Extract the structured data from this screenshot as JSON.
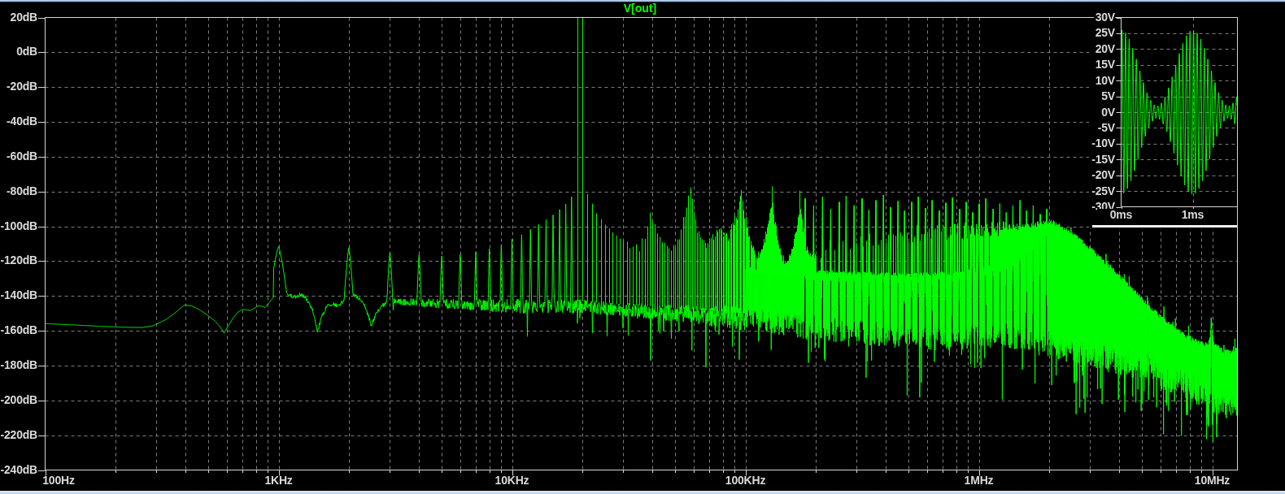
{
  "window": {
    "background": "#000000",
    "chrome_color": "#b9d1f4"
  },
  "chart_data": [
    {
      "type": "line",
      "name": "fft-of-V(out)",
      "title": "V[out]",
      "trace_color": "#00ff00",
      "grid_color": "#7e7e7e",
      "border_color": "#d6d6d6",
      "label_color": "#dadada",
      "x_scale": "log",
      "x_range_hz": [
        100,
        12830000
      ],
      "y_range_db": [
        -240,
        20
      ],
      "y_step_db": 20,
      "grid": true,
      "y_tick_labels": [
        "20dB",
        "0dB",
        "-20dB",
        "-40dB",
        "-60dB",
        "-80dB",
        "-100dB",
        "-120dB",
        "-140dB",
        "-160dB",
        "-180dB",
        "-200dB",
        "-220dB",
        "-240dB"
      ],
      "x_tick_labels": [
        "100Hz",
        "1KHz",
        "10KHz",
        "100KHz",
        "1MHz",
        "10MHz"
      ],
      "x_tick_hz": [
        100,
        1000,
        10000,
        100000,
        1000000,
        10000000
      ],
      "carrier_peak": {
        "freq_hz": 20000,
        "clipped_above_db": 20,
        "sideband_hz": 19000
      },
      "comb_spacing_hz": 1000,
      "low_freq_curve_hz_db": [
        [
          100,
          -155.9
        ],
        [
          130,
          -156.6
        ],
        [
          170,
          -157.4
        ],
        [
          220,
          -158.0
        ],
        [
          260,
          -158.1
        ],
        [
          290,
          -157.2
        ],
        [
          330,
          -153.5
        ],
        [
          360,
          -149.8
        ],
        [
          395,
          -145.2
        ],
        [
          420,
          -145.6
        ],
        [
          450,
          -147.3
        ],
        [
          490,
          -150.5
        ],
        [
          530,
          -154.0
        ],
        [
          560,
          -157.5
        ],
        [
          585,
          -161.3
        ],
        [
          610,
          -157.0
        ],
        [
          640,
          -152.5
        ],
        [
          670,
          -149.3
        ],
        [
          700,
          -147.7
        ],
        [
          730,
          -148.0
        ],
        [
          760,
          -148.3
        ],
        [
          790,
          -146.9
        ],
        [
          820,
          -145.6
        ],
        [
          850,
          -145.9
        ],
        [
          875,
          -146.8
        ],
        [
          900,
          -144.6
        ],
        [
          930,
          -142.3
        ],
        [
          955,
          -140.5
        ],
        [
          975,
          -139.2
        ]
      ],
      "comb_envelope_hz_db": [
        [
          1000,
          -111.7
        ],
        [
          2000,
          -112.3
        ],
        [
          3000,
          -114.8
        ],
        [
          4000,
          -116.3
        ],
        [
          5000,
          -117.0
        ],
        [
          6000,
          -116.2
        ],
        [
          7000,
          -114.6
        ],
        [
          8000,
          -112.8
        ],
        [
          9000,
          -110.4
        ],
        [
          10000,
          -107.4
        ],
        [
          11000,
          -104.8
        ],
        [
          12000,
          -101.8
        ],
        [
          13000,
          -99.0
        ],
        [
          14000,
          -96.2
        ],
        [
          15000,
          -93.4
        ],
        [
          16000,
          -90.4
        ],
        [
          17000,
          -87.2
        ],
        [
          18000,
          -83.0
        ],
        [
          21000,
          -81.5
        ],
        [
          22000,
          -87.0
        ],
        [
          23000,
          -92.5
        ],
        [
          24000,
          -96.0
        ],
        [
          25000,
          -99.0
        ],
        [
          27000,
          -103.5
        ],
        [
          29000,
          -107.0
        ],
        [
          31000,
          -109.5
        ],
        [
          33000,
          -111.0
        ],
        [
          35000,
          -112.0
        ],
        [
          36500,
          -108.0
        ],
        [
          38000,
          -99.0
        ],
        [
          39000,
          -94.0
        ],
        [
          40000,
          -95.5
        ],
        [
          41000,
          -99.0
        ],
        [
          42500,
          -105.0
        ],
        [
          44000,
          -109.0
        ],
        [
          46000,
          -112.0
        ],
        [
          48000,
          -112.5
        ],
        [
          50000,
          -110.0
        ],
        [
          52000,
          -105.0
        ],
        [
          54000,
          -97.0
        ],
        [
          55000,
          -93.0
        ],
        [
          56000,
          -87.0
        ],
        [
          57000,
          -82.0
        ],
        [
          58000,
          -77.3
        ],
        [
          59000,
          -86.0
        ],
        [
          60000,
          -92.0
        ],
        [
          61000,
          -97.0
        ],
        [
          62000,
          -102.0
        ],
        [
          64000,
          -107.0
        ],
        [
          66000,
          -110.0
        ],
        [
          68000,
          -110.5
        ],
        [
          70000,
          -109.0
        ],
        [
          72000,
          -106.5
        ],
        [
          74000,
          -104.0
        ],
        [
          76000,
          -102.0
        ],
        [
          78000,
          -103.0
        ],
        [
          80000,
          -105.0
        ],
        [
          82000,
          -106.5
        ],
        [
          84000,
          -106.0
        ],
        [
          86000,
          -103.0
        ],
        [
          88000,
          -99.0
        ],
        [
          90000,
          -95.0
        ],
        [
          92000,
          -95.0
        ],
        [
          94000,
          -88.0
        ],
        [
          95000,
          -83.0
        ],
        [
          96000,
          -77.6
        ],
        [
          97000,
          -87.0
        ],
        [
          98500,
          -93.0
        ],
        [
          101000,
          -99.0
        ],
        [
          103000,
          -104.0
        ],
        [
          106000,
          -110.0
        ],
        [
          109000,
          -114.0
        ],
        [
          112000,
          -116.5
        ],
        [
          115000,
          -116.0
        ],
        [
          118000,
          -112.0
        ],
        [
          121000,
          -107.0
        ],
        [
          124000,
          -100.0
        ],
        [
          127000,
          -94.0
        ],
        [
          129000,
          -89.0
        ],
        [
          130000,
          -78.6
        ],
        [
          131000,
          -89.0
        ],
        [
          133000,
          -97.0
        ],
        [
          134000,
          -99.0
        ],
        [
          137000,
          -107.0
        ],
        [
          140000,
          -113.0
        ],
        [
          144000,
          -118.0
        ],
        [
          148000,
          -120.5
        ],
        [
          152000,
          -119.0
        ],
        [
          157000,
          -114.0
        ],
        [
          162000,
          -107.0
        ],
        [
          166000,
          -99.0
        ],
        [
          168500,
          -95.0
        ],
        [
          170000,
          -88.0
        ],
        [
          171000,
          -79.2
        ],
        [
          172000,
          -89.0
        ],
        [
          174000,
          -97.0
        ],
        [
          176000,
          -101.0
        ],
        [
          180000,
          -109.0
        ],
        [
          185000,
          -115.0
        ],
        [
          190000,
          -118.0
        ],
        [
          196000,
          -118.0
        ],
        [
          215000,
          -113.0
        ],
        [
          250000,
          -110.0
        ],
        [
          300000,
          -107.5
        ],
        [
          400000,
          -105.5
        ],
        [
          550000,
          -104.0
        ],
        [
          800000,
          -102.5
        ],
        [
          1200000,
          -101.0
        ],
        [
          1600000,
          -99.5
        ],
        [
          1900000,
          -98.3
        ],
        [
          2050000,
          -98.0
        ],
        [
          2200000,
          -99.5
        ],
        [
          2400000,
          -102.5
        ],
        [
          2700000,
          -107.5
        ],
        [
          3000000,
          -112.5
        ],
        [
          3400000,
          -119.0
        ],
        [
          3800000,
          -125.5
        ],
        [
          4200000,
          -131.5
        ],
        [
          4700000,
          -138.0
        ],
        [
          5200000,
          -144.0
        ],
        [
          5800000,
          -150.0
        ],
        [
          6400000,
          -155.0
        ],
        [
          7000000,
          -159.0
        ],
        [
          7600000,
          -162.3
        ],
        [
          8200000,
          -164.8
        ],
        [
          8800000,
          -166.5
        ],
        [
          9400000,
          -167.8
        ],
        [
          9700000,
          -166.5
        ],
        [
          9820000,
          -161.0
        ],
        [
          9900000,
          -155.0
        ],
        [
          9990000,
          -161.0
        ],
        [
          10200000,
          -167.0
        ],
        [
          10700000,
          -170.0
        ],
        [
          11300000,
          -171.8
        ],
        [
          12000000,
          -172.3
        ],
        [
          12500000,
          -171.8
        ],
        [
          12830000,
          -170.5
        ]
      ],
      "spurs_hz_db": [
        [
          180000,
          -84
        ],
        [
          196000,
          -88
        ],
        [
          214000,
          -83
        ],
        [
          232000,
          -90
        ],
        [
          252000,
          -86
        ],
        [
          270000,
          -82.5
        ],
        [
          292000,
          -88
        ],
        [
          315000,
          -84
        ],
        [
          338000,
          -90.5
        ],
        [
          362000,
          -85
        ],
        [
          390000,
          -82
        ],
        [
          418000,
          -89
        ],
        [
          450000,
          -85.5
        ],
        [
          480000,
          -91
        ],
        [
          515000,
          -86
        ],
        [
          550000,
          -83
        ],
        [
          590000,
          -89.5
        ],
        [
          630000,
          -85
        ],
        [
          675000,
          -91
        ],
        [
          720000,
          -86.5
        ],
        [
          770000,
          -83.5
        ],
        [
          825000,
          -90
        ],
        [
          880000,
          -86
        ],
        [
          940000,
          -92
        ],
        [
          1000000,
          -87
        ],
        [
          1070000,
          -84
        ],
        [
          1150000,
          -90
        ],
        [
          1230000,
          -87
        ],
        [
          1310000,
          -92
        ],
        [
          1400000,
          -88
        ],
        [
          1500000,
          -85
        ],
        [
          1600000,
          -91
        ],
        [
          1710000,
          -88
        ],
        [
          1830000,
          -93
        ],
        [
          1950000,
          -90
        ],
        [
          9900000,
          -152.5
        ]
      ],
      "noise_floor_hz_db": [
        [
          1000,
          -143.5
        ],
        [
          2000,
          -142.5
        ],
        [
          3000,
          -143.0
        ],
        [
          5000,
          -144.5
        ],
        [
          8000,
          -145.5
        ],
        [
          12000,
          -146.0
        ],
        [
          20000,
          -146.0
        ],
        [
          30000,
          -148.0
        ],
        [
          50000,
          -150.0
        ],
        [
          80000,
          -152.0
        ],
        [
          100000,
          -153.0
        ],
        [
          150000,
          -156.0
        ],
        [
          200000,
          -158.0
        ],
        [
          300000,
          -161.0
        ],
        [
          500000,
          -163.5
        ],
        [
          800000,
          -165.0
        ],
        [
          1000000,
          -162.5
        ],
        [
          1500000,
          -163.5
        ],
        [
          2000000,
          -167.0
        ],
        [
          3000000,
          -174.0
        ],
        [
          5000000,
          -180.0
        ],
        [
          8000000,
          -192.0
        ],
        [
          10000000,
          -200.0
        ],
        [
          12830000,
          -203.0
        ]
      ],
      "solid_core_hz_db": [
        [
          100000,
          -124
        ],
        [
          130000,
          -125
        ],
        [
          200000,
          -126
        ],
        [
          300000,
          -127
        ],
        [
          500000,
          -128
        ],
        [
          800000,
          -127
        ],
        [
          1000000,
          -125
        ],
        [
          1200000,
          -122
        ],
        [
          1400000,
          -118
        ],
        [
          1600000,
          -112
        ],
        [
          1800000,
          -106
        ],
        [
          2000000,
          -101
        ],
        [
          2150000,
          -99
        ],
        [
          2400000,
          -102.5
        ]
      ],
      "floor_detail_hz_db": [
        [
          958,
          -139.6
        ],
        [
          1050,
          -140.0
        ],
        [
          1100,
          -139.5
        ],
        [
          1170,
          -140.5
        ],
        [
          1250,
          -139.0
        ],
        [
          1320,
          -142.0
        ],
        [
          1400,
          -148.0
        ],
        [
          1470,
          -161.0
        ],
        [
          1530,
          -152.0
        ],
        [
          1600,
          -146.5
        ],
        [
          1700,
          -144.5
        ],
        [
          1800,
          -145.5
        ],
        [
          1900,
          -143.0
        ],
        [
          2080,
          -139.5
        ],
        [
          2200,
          -141.0
        ],
        [
          2350,
          -146.0
        ],
        [
          2500,
          -157.0
        ],
        [
          2620,
          -150.0
        ],
        [
          2750,
          -146.0
        ],
        [
          2900,
          -144.0
        ],
        [
          3100,
          -143.2
        ]
      ],
      "floor_spread_hz_db": [
        [
          1000,
          1.5
        ],
        [
          3000,
          2.0
        ],
        [
          6000,
          3.0
        ],
        [
          10000,
          4.0
        ],
        [
          30000,
          4.0
        ],
        [
          60000,
          5.5
        ],
        [
          100000,
          7.0
        ],
        [
          300000,
          7.0
        ],
        [
          1000000,
          7.0
        ],
        [
          3000000,
          8.0
        ],
        [
          12830000,
          9.0
        ]
      ],
      "down_spike_prob": [
        [
          1000,
          0.003
        ],
        [
          5000,
          0.008
        ],
        [
          10000,
          0.012
        ],
        [
          20000,
          0.03
        ],
        [
          100000,
          0.045
        ],
        [
          500000,
          0.06
        ],
        [
          2000000,
          0.1
        ],
        [
          12830000,
          0.14
        ]
      ],
      "down_spike_depth_db": [
        [
          1000,
          8
        ],
        [
          5000,
          14
        ],
        [
          10000,
          20
        ],
        [
          50000,
          24
        ],
        [
          200000,
          30
        ],
        [
          1000000,
          32
        ],
        [
          5000000,
          34
        ],
        [
          12830000,
          26
        ]
      ]
    },
    {
      "type": "line",
      "name": "V(out)-time-domain-inset",
      "trace_color": "#00ff00",
      "signal": {
        "kind": "amplitude-modulated-sine",
        "carrier_hz": 20000,
        "carrier_amplitude_v": 14,
        "modulation_hz": 1000,
        "modulation_index": 0.857,
        "envelope_max_v": 26,
        "envelope_min_v": 2
      },
      "x_range_ms": [
        0,
        1.625
      ],
      "y_range_v": [
        -30,
        30
      ],
      "y_step_v": 5,
      "grid": true,
      "y_tick_labels": [
        "30V",
        "25V",
        "20V",
        "15V",
        "10V",
        "5V",
        "0V",
        "-5V",
        "-10V",
        "-15V",
        "-20V",
        "-25V",
        "-30V"
      ],
      "x_tick_labels": [
        "0ms",
        "1ms"
      ],
      "x_tick_ms": [
        0,
        1
      ]
    }
  ]
}
